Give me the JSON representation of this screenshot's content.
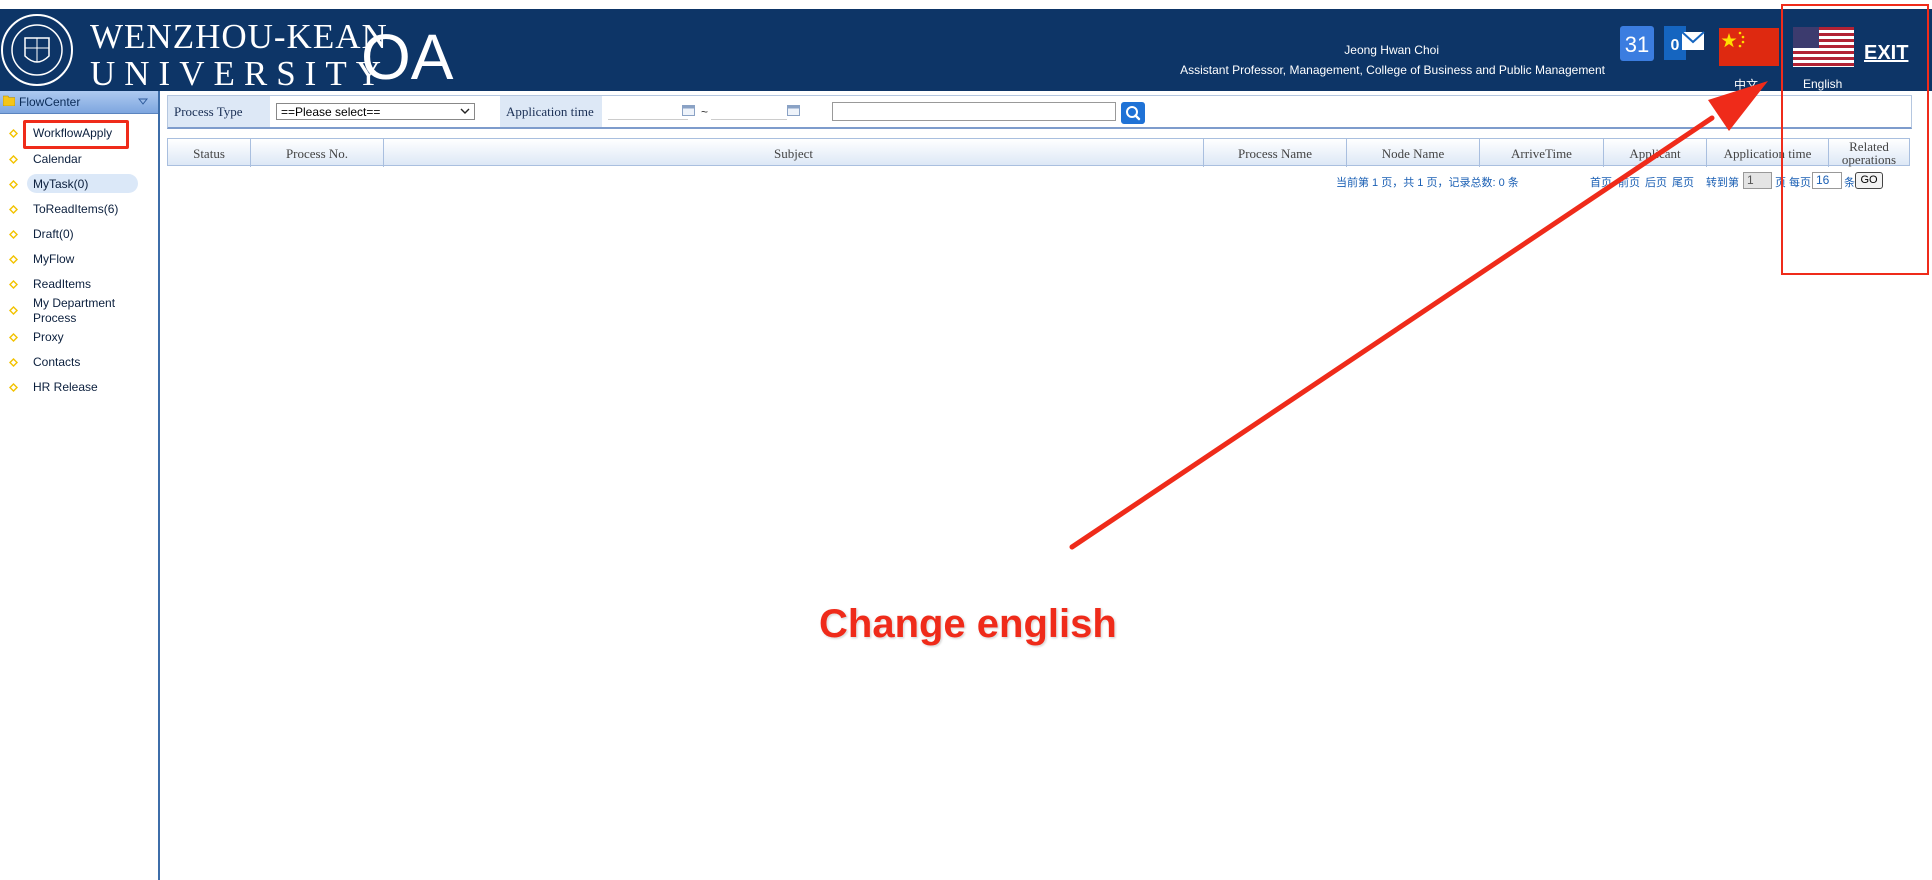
{
  "header": {
    "logo_line1": "WENZHOU-KEAN",
    "logo_line2": "UNIVERSITY",
    "logo_oa": "OA",
    "user_name": "Jeong Hwan Choi",
    "user_title": "Assistant Professor, Management, College of Business and Public Management",
    "calendar_badge": "31",
    "mail_badge": "0",
    "lang_cn": "中文",
    "lang_en": "English",
    "exit": "EXIT"
  },
  "sidebar": {
    "title": "FlowCenter",
    "items": [
      {
        "label": "WorkflowApply"
      },
      {
        "label": "Calendar"
      },
      {
        "label": "MyTask(0)"
      },
      {
        "label": "ToReadItems(6)"
      },
      {
        "label": "Draft(0)"
      },
      {
        "label": "MyFlow"
      },
      {
        "label": "ReadItems"
      },
      {
        "label": "My Department Process"
      },
      {
        "label": "Proxy"
      },
      {
        "label": "Contacts"
      },
      {
        "label": "HR Release"
      }
    ]
  },
  "search": {
    "process_type_label": "Process Type",
    "process_type_value": "==Please select==",
    "application_time_label": "Application time",
    "tilde": "~"
  },
  "grid": {
    "columns": [
      "Status",
      "Process No.",
      "Subject",
      "Process Name",
      "Node Name",
      "ArriveTime",
      "Applicant",
      "Application time",
      "Related operations"
    ]
  },
  "pager": {
    "summary": "当前第 1 页，共 1 页，记录总数: 0 条",
    "first": "首页",
    "prev": "前页",
    "next": "后页",
    "last": "尾页",
    "goto_label": "转到第",
    "page_value": "1",
    "page_unit": "页",
    "per_page_label": "每页",
    "per_page_value": "16",
    "per_page_unit": "条",
    "go": "GO"
  },
  "annotation": {
    "text": "Change english",
    "color": "#ef2b1a"
  },
  "colors": {
    "header_bg": "#0d3567",
    "accent_blue": "#1f72d6",
    "annotation_red": "#ef2b1a"
  }
}
